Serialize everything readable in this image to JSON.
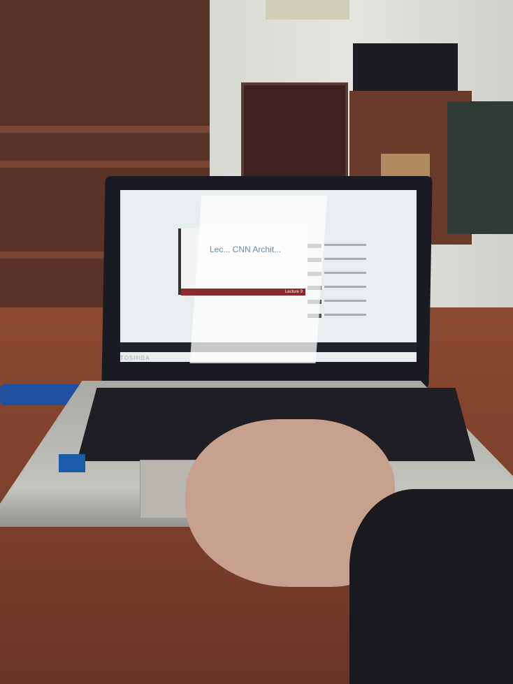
{
  "scene": {
    "description_colors": {
      "desk": "#7a3e2a",
      "wall": "#e4e4e0",
      "laptop_lid": "#1a1a22",
      "laptop_base": "#c4c4be"
    }
  },
  "laptop": {
    "brand": "TOSHIBA",
    "screen": {
      "video_title": "Lec... CNN Archit...",
      "video_bar_label": "Lecture 9"
    }
  }
}
